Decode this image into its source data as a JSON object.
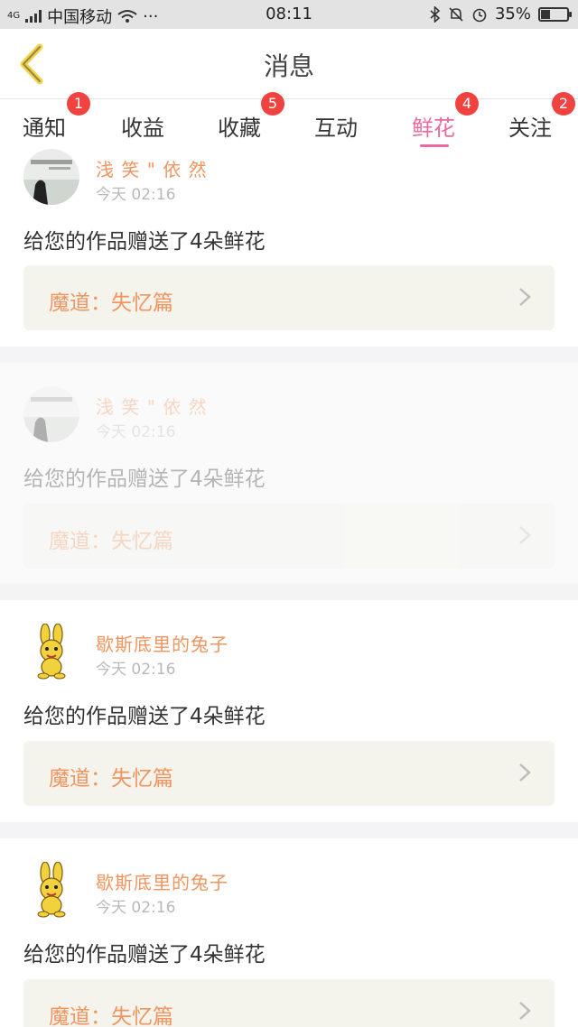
{
  "status_bar": {
    "network": "4G",
    "carrier": "中国移动",
    "more": "···",
    "time": "08:11",
    "battery": "35%",
    "battery_level": 0.35
  },
  "header": {
    "title": "消息",
    "back_icon": "chevron-left-icon"
  },
  "tabs": [
    {
      "label": "通知",
      "badge": "1"
    },
    {
      "label": "收益",
      "badge": ""
    },
    {
      "label": "收藏",
      "badge": "5"
    },
    {
      "label": "互动",
      "badge": ""
    },
    {
      "label": "鲜花",
      "badge": "4",
      "active": true
    },
    {
      "label": "关注",
      "badge": "2"
    }
  ],
  "messages": [
    {
      "user": "浅 笑 \" 依 然",
      "time": "今天 02:16",
      "text": "给您的作品赠送了4朵鲜花",
      "work": "魔道：失忆篇"
    },
    {
      "user": "浅 笑 \" 依 然",
      "time": "今天 02:16",
      "text": "给您的作品赠送了4朵鲜花",
      "work": "魔道：失忆篇"
    },
    {
      "user": "歇斯底里的兔子",
      "time": "今天 02:16",
      "text": "给您的作品赠送了4朵鲜花",
      "work": "魔道：失忆篇"
    },
    {
      "user": "歇斯底里的兔子",
      "time": "今天 02:16",
      "text": "给您的作品赠送了4朵鲜花",
      "work": "魔道：失忆篇"
    }
  ],
  "colors": {
    "accent": "#e96aa0",
    "badge": "#f0423f",
    "name": "#f0955f"
  }
}
